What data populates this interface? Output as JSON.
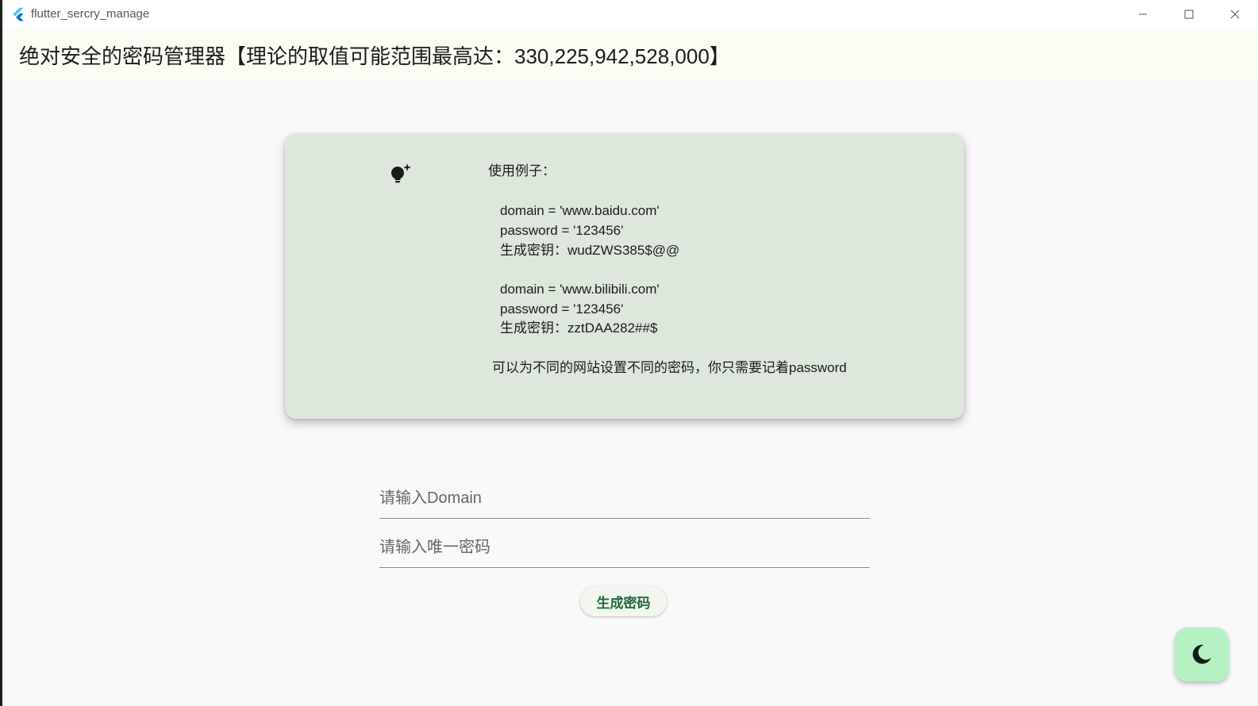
{
  "window": {
    "title": "flutter_sercry_manage",
    "controls": [
      "minimize-icon",
      "maximize-icon",
      "close-icon"
    ]
  },
  "appbar": {
    "title": "绝对安全的密码管理器【理论的取值可能范围最高达：330,225,942,528,000】"
  },
  "card": {
    "icon": "lightbulb-sparkle-icon",
    "heading": "使用例子：",
    "example1_domain": "domain = 'www.baidu.com'",
    "example1_password": "password = '123456'",
    "example1_key": "生成密钥：wudZWS385$@@",
    "example2_domain": "domain = 'www.bilibili.com'",
    "example2_password": "password = '123456'",
    "example2_key": "生成密钥：zztDAA282##$",
    "footer": "可以为不同的网站设置不同的密码，你只需要记着password"
  },
  "form": {
    "domain_placeholder": "请输入Domain",
    "domain_value": "",
    "password_placeholder": "请输入唯一密码",
    "password_value": "",
    "generate_label": "生成密码"
  },
  "fab": {
    "icon": "moon-icon"
  },
  "colors": {
    "card_bg": "#dde7dc",
    "appbar_bg": "#fbfcf4",
    "button_text": "#1e6b3a",
    "fab_bg": "#b6f1c3"
  }
}
